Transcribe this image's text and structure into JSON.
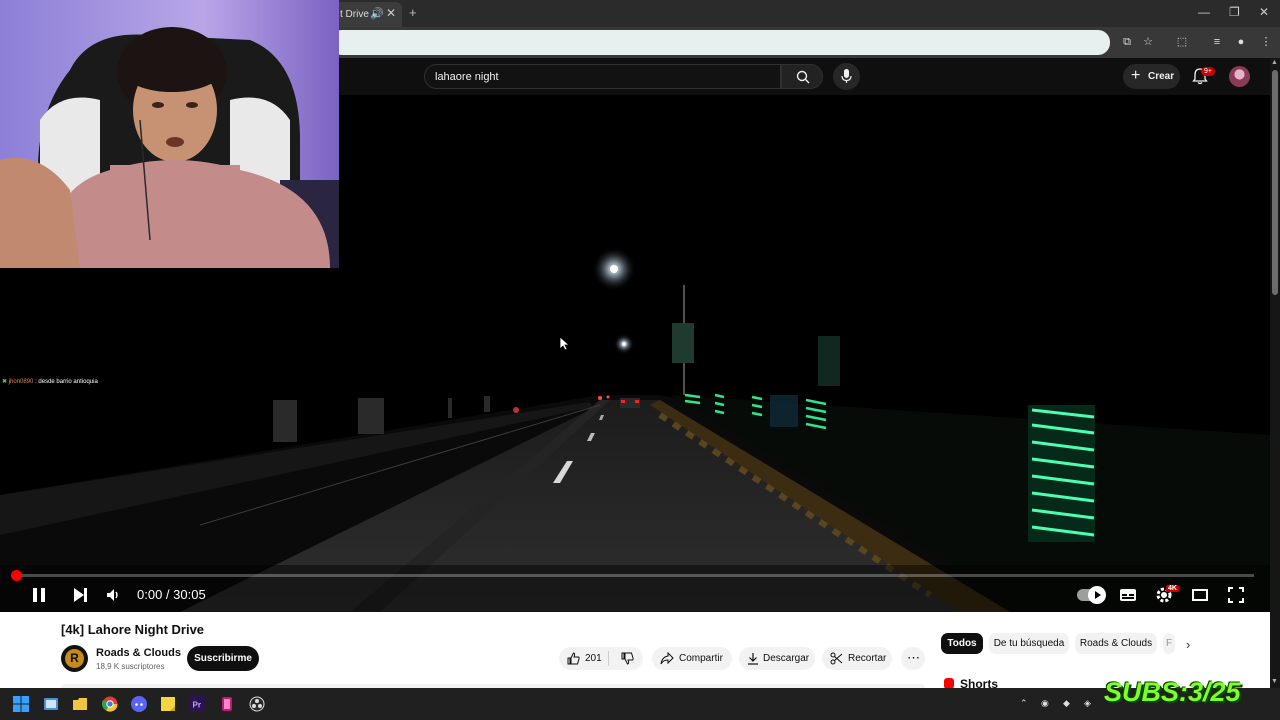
{
  "browser": {
    "tab_title": "t Drive",
    "new_tab": "+"
  },
  "youtube": {
    "search": {
      "query": "lahaore night"
    },
    "create_label": "Crear",
    "notification_badge": "9+"
  },
  "player": {
    "time": "0:00 / 30:05",
    "progress_percent": 0,
    "quality_badge": "4K"
  },
  "overlay": {
    "chat_user": "jhon0890",
    "chat_message": ": desde barrio antioquia",
    "subs_counter": "SUBS:3/25"
  },
  "video": {
    "title": "[4k] Lahore Night Drive",
    "channel_name": "Roads & Clouds",
    "channel_initial": "R",
    "subscribers": "18,9 K suscriptores",
    "subscribe_label": "Suscribirme",
    "like_count": "201",
    "share_label": "Compartir",
    "download_label": "Descargar",
    "clip_label": "Recortar"
  },
  "sidebar": {
    "chips": [
      "Todos",
      "De tu búsqueda",
      "Roads & Clouds",
      "F"
    ],
    "shorts_label": "Shorts"
  },
  "colors": {
    "accent_red": "#ff0000",
    "subs_green": "#7cff2a"
  }
}
